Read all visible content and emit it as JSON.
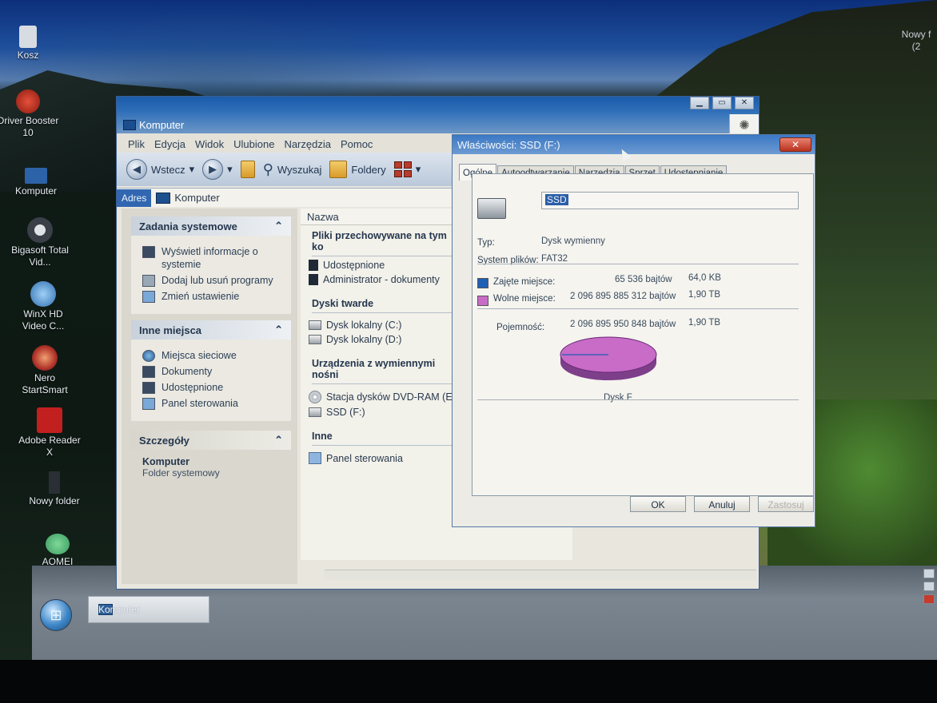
{
  "desktop": {
    "icons": [
      {
        "label": "Kosz",
        "color": "#d7dce2"
      },
      {
        "label": "Driver Booster 10",
        "color": "#c92a1c"
      },
      {
        "label": "Komputer",
        "color": "#2c63a8"
      },
      {
        "label": "Bigasoft Total Vid...",
        "color": "#3a3f48"
      },
      {
        "label": "WinX HD Video C...",
        "color": "#3f7fc4"
      },
      {
        "label": "Nero StartSmart",
        "color": "#b0332a"
      },
      {
        "label": "Adobe Reader X",
        "color": "#c21f1f"
      },
      {
        "label": "Nowy folder",
        "color": "#2a2e35"
      },
      {
        "label": "AOMEI Partition ...",
        "color": "#3a9b5e"
      }
    ],
    "corner_text_1": "Nowy f",
    "corner_text_2": "(2"
  },
  "taskbar": {
    "start_glyph": "⊞",
    "item_label": "Komputer"
  },
  "explorer": {
    "title": "Komputer",
    "menu": [
      "Plik",
      "Edycja",
      "Widok",
      "Ulubione",
      "Narzędzia",
      "Pomoc"
    ],
    "toolbar": {
      "back": "Wstecz",
      "search": "Wyszukaj",
      "folders": "Foldery"
    },
    "address_label": "Adres",
    "address_value": "Komputer",
    "panels": {
      "system_tasks": {
        "title": "Zadania systemowe",
        "links": [
          "Wyświetl informacje o systemie",
          "Dodaj lub usuń programy",
          "Zmień ustawienie"
        ]
      },
      "other_places": {
        "title": "Inne miejsca",
        "links": [
          "Miejsca sieciowe",
          "Dokumenty",
          "Udostępnione",
          "Panel sterowania"
        ]
      },
      "details": {
        "title": "Szczegóły",
        "name": "Komputer",
        "type": "Folder systemowy"
      }
    },
    "column_header": "Nazwa",
    "groups": [
      {
        "title": "Pliki przechowywane na tym ko",
        "items": [
          "Udostępnione",
          "Administrator - dokumenty"
        ]
      },
      {
        "title": "Dyski twarde",
        "items": [
          "Dysk lokalny (C:)",
          "Dysk lokalny (D:)"
        ]
      },
      {
        "title": "Urządzenia z wymiennymi nośni",
        "items": [
          "Stacja dysków DVD-RAM (E:)",
          "SSD (F:)"
        ]
      },
      {
        "title": "Inne",
        "items": [
          "Panel sterowania"
        ]
      }
    ]
  },
  "properties": {
    "title": "Właściwości: SSD (F:)",
    "tabs": [
      "Ogólne",
      "Autoodtwarzanie",
      "Narzędzia",
      "Sprzęt",
      "Udostępnianie"
    ],
    "name_value": "SSD",
    "type_label": "Typ:",
    "type_value": "Dysk wymienny",
    "fs_label": "System plików:",
    "fs_value": "FAT32",
    "used_label": "Zajęte miejsce:",
    "used_bytes": "65 536 bajtów",
    "used_size": "64,0 KB",
    "free_label": "Wolne miejsce:",
    "free_bytes": "2 096 895 885 312 bajtów",
    "free_size": "1,90 TB",
    "capacity_label": "Pojemność:",
    "capacity_bytes": "2 096 895 950 848 bajtów",
    "capacity_size": "1,90 TB",
    "disk_caption": "Dysk F",
    "used_color": "#1f5fb5",
    "free_color": "#c86cc8",
    "buttons": {
      "ok": "OK",
      "cancel": "Anuluj",
      "apply": "Zastosuj"
    }
  }
}
